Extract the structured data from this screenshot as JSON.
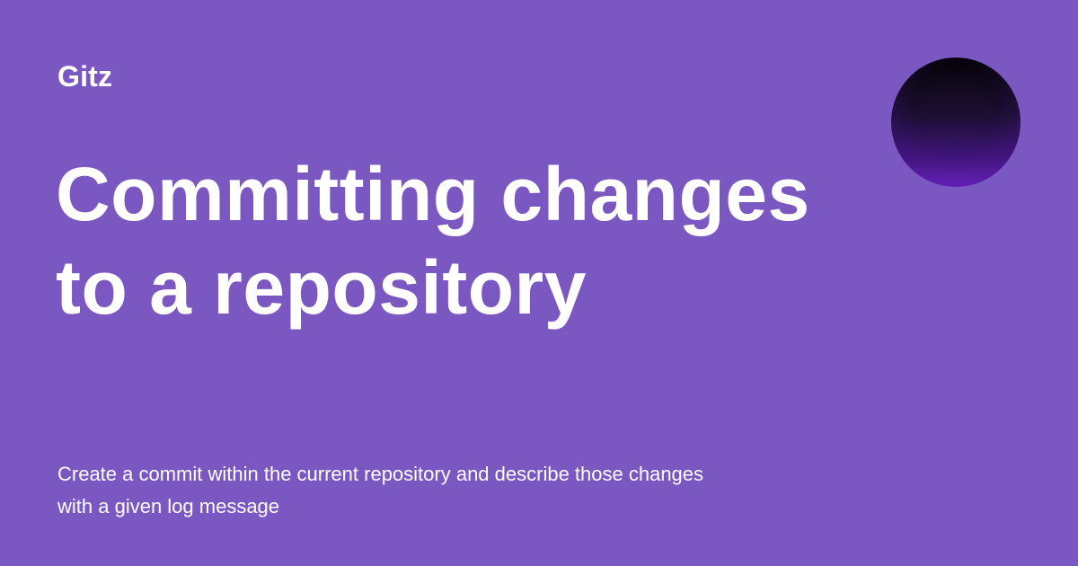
{
  "brand": {
    "name": "Gitz"
  },
  "hero": {
    "title": "Committing changes to a repository",
    "description": "Create a commit within the current repository and describe those changes with a given log message"
  },
  "colors": {
    "background": "#7b57c1",
    "text": "#ffffff",
    "orb_top": "#050308",
    "orb_bottom": "#6c24c1"
  },
  "decorative": {
    "orb": "dark-purple-gradient-circle"
  }
}
